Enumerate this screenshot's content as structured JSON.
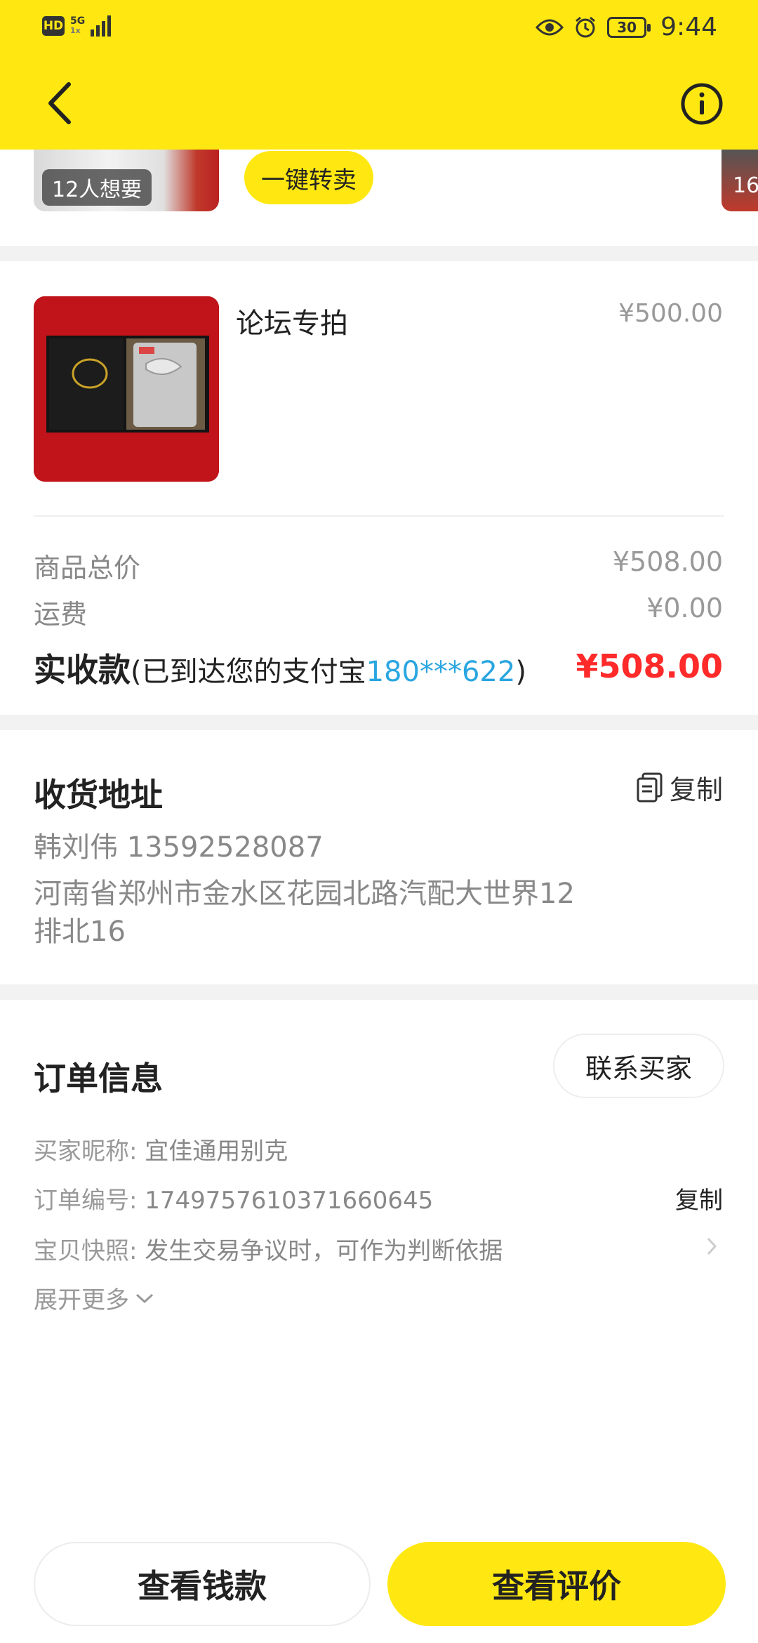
{
  "status_bar": {
    "hd": "HD",
    "network": "5G",
    "network_sub": "1x",
    "battery": "30",
    "time": "9:44"
  },
  "top_strip": {
    "want_badge": "12人想要",
    "resell_button": "一键转卖",
    "right_thumb_text": "16"
  },
  "product": {
    "title": "论坛专拍",
    "price": "¥500.00"
  },
  "summary": {
    "total_label": "商品总价",
    "total_value": "¥508.00",
    "shipping_label": "运费",
    "shipping_value": "¥0.00",
    "received_label": "实收款",
    "received_note_prefix": "(已到达您的支付宝",
    "received_account": "180***622",
    "received_note_suffix": ")",
    "received_amount": "¥508.00"
  },
  "address": {
    "title": "收货地址",
    "copy_label": "复制",
    "name_phone": "韩刘伟 13592528087",
    "line1": "河南省郑州市金水区花园北路汽配大世界12",
    "line2": "排北16"
  },
  "order_info": {
    "title": "订单信息",
    "contact_button": "联系买家",
    "buyer_label": "买家昵称:",
    "buyer_value": "宜佳通用别克",
    "order_no_label": "订单编号:",
    "order_no_value": "1749757610371660645",
    "copy_label": "复制",
    "snapshot_label": "宝贝快照:",
    "snapshot_value": "发生交易争议时，可作为判断依据",
    "expand_label": "展开更多"
  },
  "bottom": {
    "view_money": "查看钱款",
    "view_review": "查看评价"
  },
  "colors": {
    "brand_yellow": "#ffe811",
    "price_red": "#ff2a2a",
    "link_blue": "#2aa6e0"
  }
}
